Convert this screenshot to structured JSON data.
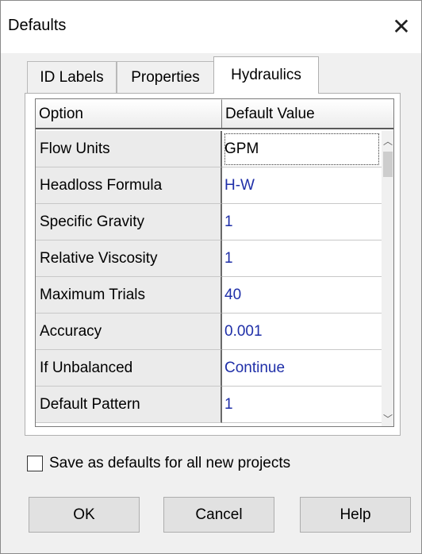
{
  "window": {
    "title": "Defaults"
  },
  "tabs": [
    {
      "label": "ID Labels",
      "active": false
    },
    {
      "label": "Properties",
      "active": false
    },
    {
      "label": "Hydraulics",
      "active": true
    }
  ],
  "grid": {
    "headers": [
      "Option",
      "Default Value"
    ],
    "rows": [
      {
        "option": "Flow Units",
        "value": "GPM"
      },
      {
        "option": "Headloss Formula",
        "value": "H-W"
      },
      {
        "option": "Specific Gravity",
        "value": "1"
      },
      {
        "option": "Relative Viscosity",
        "value": "1"
      },
      {
        "option": "Maximum Trials",
        "value": "40"
      },
      {
        "option": "Accuracy",
        "value": "0.001"
      },
      {
        "option": "If Unbalanced",
        "value": "Continue"
      },
      {
        "option": "Default Pattern",
        "value": "1"
      }
    ],
    "selected_value_color": "#000000",
    "value_color": "#1f2fa8"
  },
  "checkbox": {
    "label": "Save as defaults for all new projects",
    "checked": false
  },
  "buttons": {
    "ok": "OK",
    "cancel": "Cancel",
    "help": "Help"
  },
  "icons": {
    "close": "close-icon",
    "scroll_up": "chevron-up-icon",
    "scroll_down": "chevron-down-icon"
  }
}
